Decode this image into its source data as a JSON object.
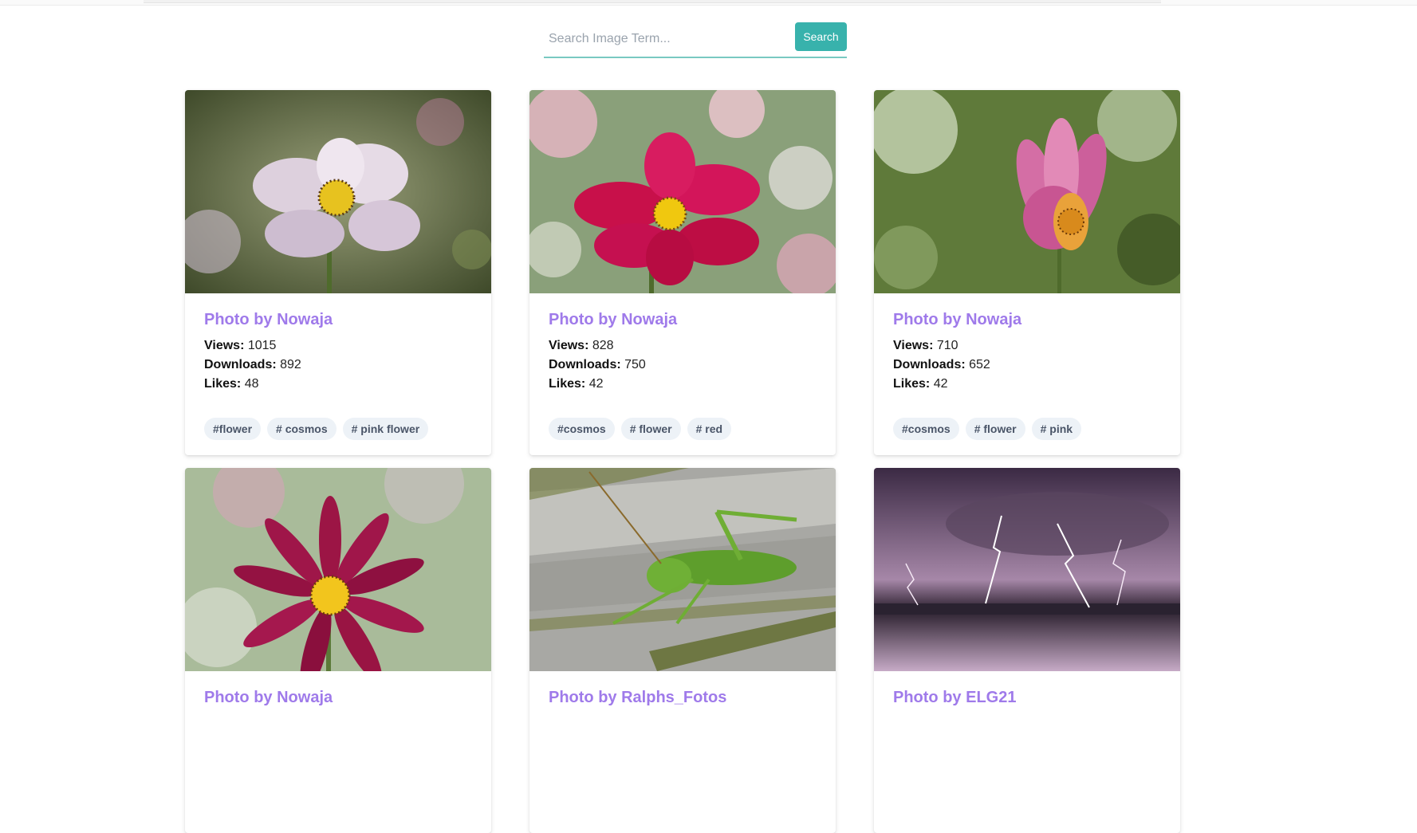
{
  "search": {
    "placeholder": "Search Image Term...",
    "button_label": "Search"
  },
  "labels": {
    "views": "Views:",
    "downloads": "Downloads:",
    "likes": "Likes:"
  },
  "cards": [
    {
      "title": "Photo by Nowaja",
      "views": "1015",
      "downloads": "892",
      "likes": "48",
      "tags": [
        "#flower",
        "# cosmos",
        "# pink flower"
      ],
      "image": "white-pink cosmos flower"
    },
    {
      "title": "Photo by Nowaja",
      "views": "828",
      "downloads": "750",
      "likes": "42",
      "tags": [
        "#cosmos",
        "# flower",
        "# red"
      ],
      "image": "red cosmos flower"
    },
    {
      "title": "Photo by Nowaja",
      "views": "710",
      "downloads": "652",
      "likes": "42",
      "tags": [
        "#cosmos",
        "# flower",
        "# pink"
      ],
      "image": "pink cosmos bud"
    },
    {
      "title": "Photo by Nowaja",
      "image": "crimson cosmos flower"
    },
    {
      "title": "Photo by Ralphs_Fotos",
      "image": "green grasshopper on paving stone"
    },
    {
      "title": "Photo by ELG21",
      "image": "lightning storm over water"
    }
  ],
  "colors": {
    "accent": "#38b2ac",
    "title": "#9f7aea",
    "tag_bg": "#edf2f7"
  }
}
